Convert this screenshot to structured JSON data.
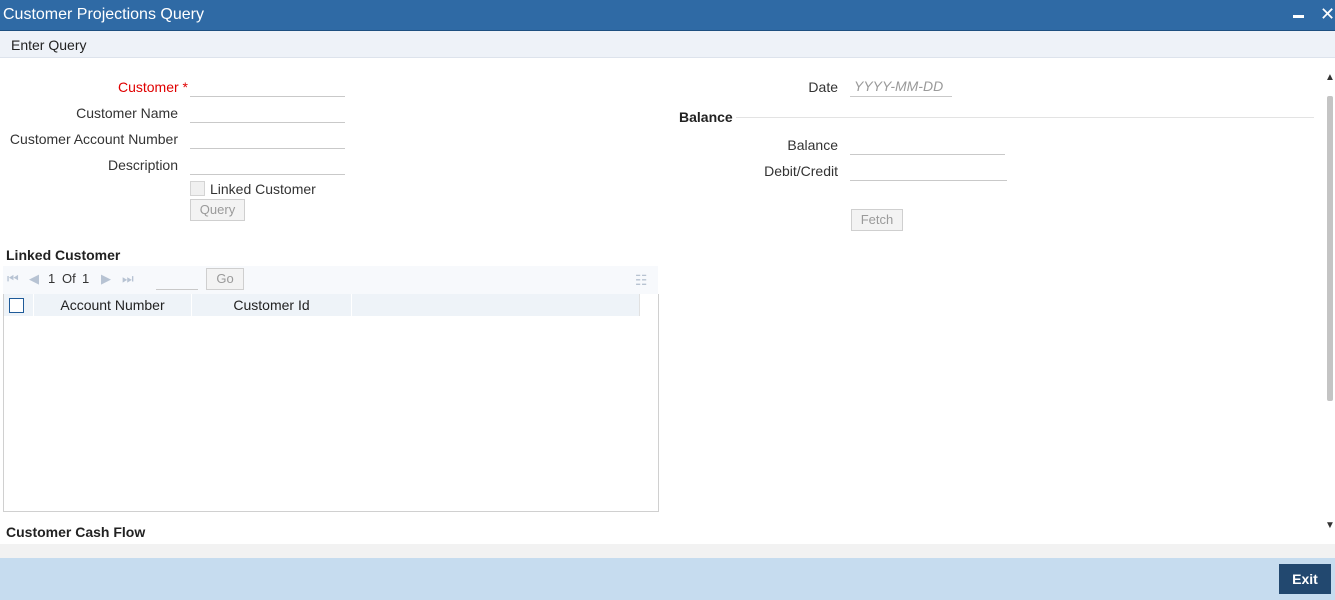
{
  "window": {
    "title": "Customer Projections Query"
  },
  "toolbar": {
    "enter_query": "Enter Query"
  },
  "form": {
    "customer_label": "Customer",
    "required_mark": "*",
    "customer_name_label": "Customer Name",
    "customer_account_label": "Customer Account Number",
    "description_label": "Description",
    "linked_customer_label": "Linked Customer",
    "query_button": "Query",
    "date_label": "Date",
    "date_placeholder": "YYYY-MM-DD"
  },
  "balance": {
    "section_title": "Balance",
    "balance_label": "Balance",
    "debit_credit_label": "Debit/Credit",
    "fetch_button": "Fetch"
  },
  "linked_customer": {
    "section_title": "Linked Customer",
    "pager": {
      "current": "1",
      "of_label": "Of",
      "total": "1",
      "go_button": "Go"
    },
    "columns": [
      "Account Number",
      "Customer Id"
    ]
  },
  "cash_flow": {
    "section_title": "Customer Cash Flow"
  },
  "footer": {
    "exit_button": "Exit"
  },
  "colors": {
    "titlebar": "#2f6aa5",
    "footer": "#c6dcef",
    "exit_button": "#22486f",
    "required": "#e00000"
  }
}
